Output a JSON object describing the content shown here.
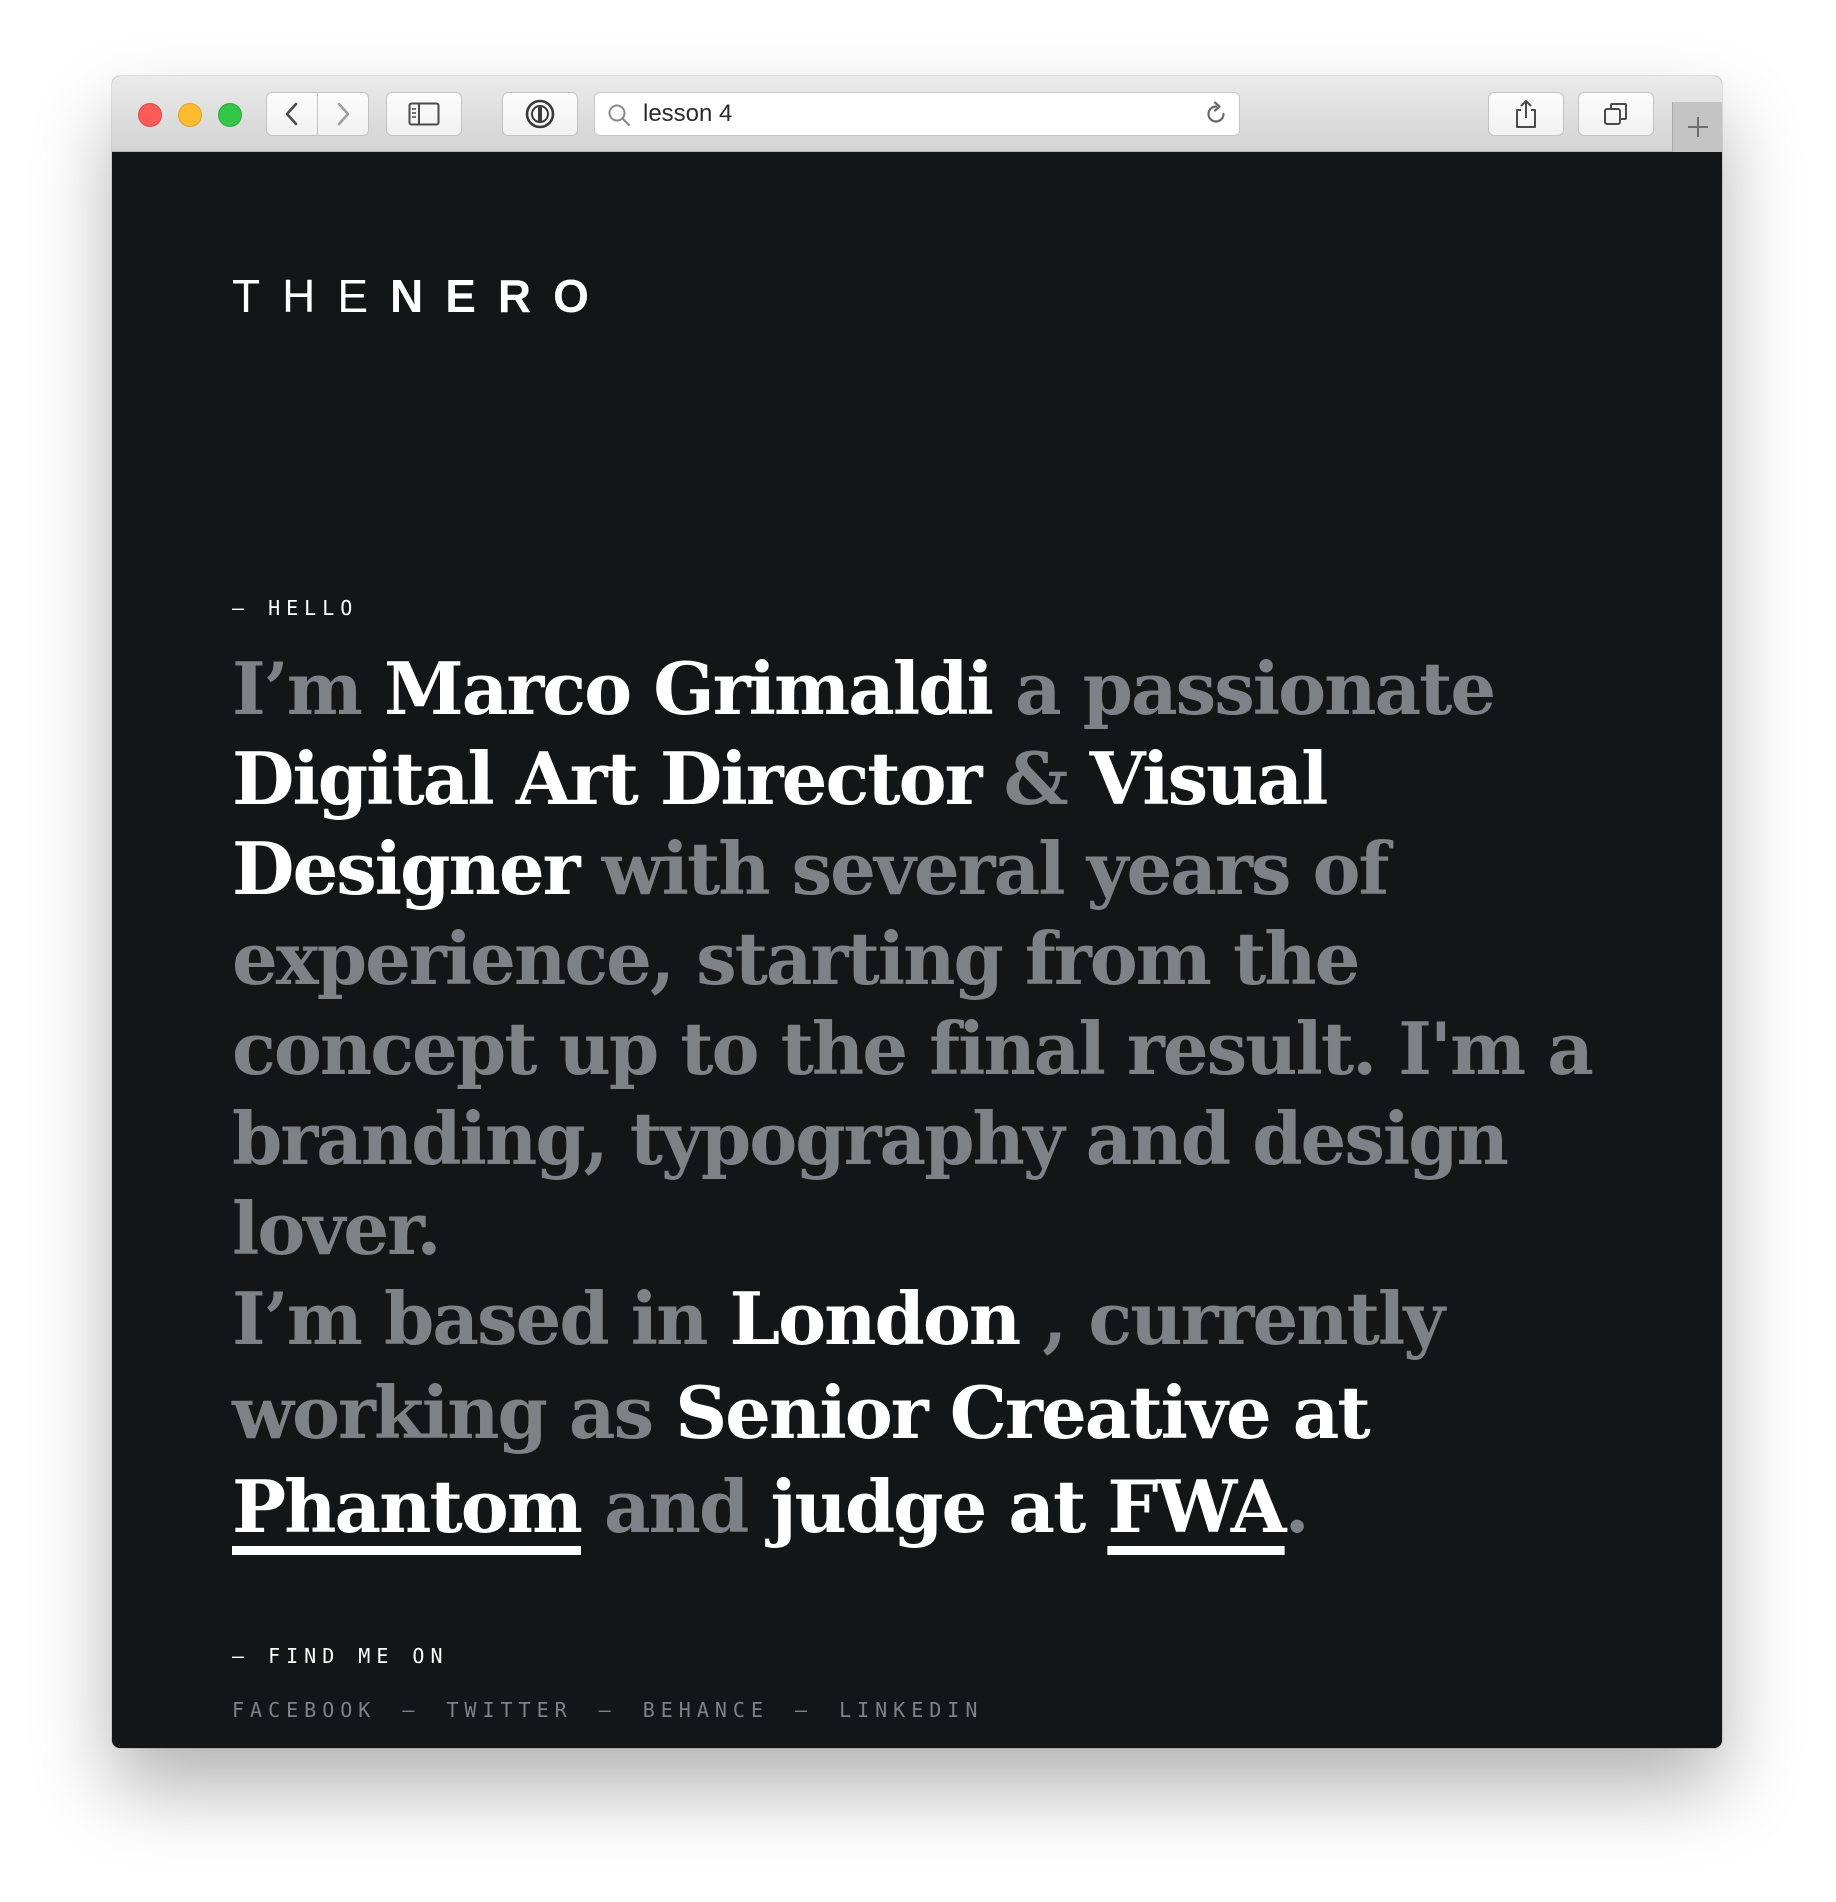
{
  "browser": {
    "address_text": "lesson 4"
  },
  "logo": {
    "thin": "THE",
    "bold": "NERO"
  },
  "hello_label": "— HELLO",
  "bio": {
    "p1": [
      "I’m ",
      "Marco Grimaldi",
      " a passionate ",
      "Digital Art Director",
      " & ",
      "Visual Designer",
      " with several years of experience, starting from the concept up to the final result. I'm a branding, typography and design lover."
    ],
    "p2": [
      "I’m based in ",
      "London",
      " , currently working as ",
      "Senior Creative at ",
      "Phantom",
      " and ",
      "judge at ",
      "FWA",
      "."
    ]
  },
  "find_label": "— FIND ME ON",
  "social": {
    "facebook": "FACEBOOK",
    "twitter": "TWITTER",
    "behance": "BEHANCE",
    "linkedin": "LINKEDIN",
    "separator": "—"
  },
  "colors": {
    "background": "#141517",
    "highlight": "#ffffff",
    "muted": "#7e8186"
  }
}
